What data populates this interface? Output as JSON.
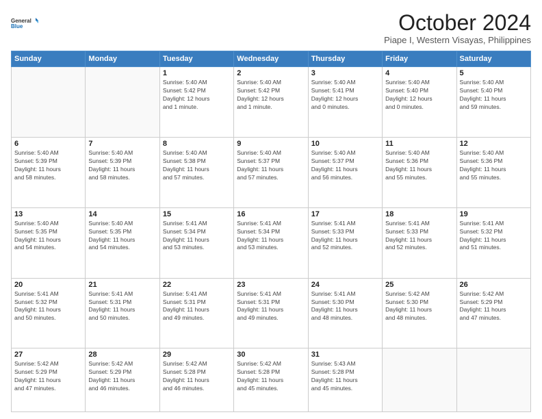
{
  "header": {
    "logo_line1": "General",
    "logo_line2": "Blue",
    "title": "October 2024",
    "subtitle": "Piape I, Western Visayas, Philippines"
  },
  "days_of_week": [
    "Sunday",
    "Monday",
    "Tuesday",
    "Wednesday",
    "Thursday",
    "Friday",
    "Saturday"
  ],
  "weeks": [
    [
      {
        "day": "",
        "info": ""
      },
      {
        "day": "",
        "info": ""
      },
      {
        "day": "1",
        "info": "Sunrise: 5:40 AM\nSunset: 5:42 PM\nDaylight: 12 hours\nand 1 minute."
      },
      {
        "day": "2",
        "info": "Sunrise: 5:40 AM\nSunset: 5:42 PM\nDaylight: 12 hours\nand 1 minute."
      },
      {
        "day": "3",
        "info": "Sunrise: 5:40 AM\nSunset: 5:41 PM\nDaylight: 12 hours\nand 0 minutes."
      },
      {
        "day": "4",
        "info": "Sunrise: 5:40 AM\nSunset: 5:40 PM\nDaylight: 12 hours\nand 0 minutes."
      },
      {
        "day": "5",
        "info": "Sunrise: 5:40 AM\nSunset: 5:40 PM\nDaylight: 11 hours\nand 59 minutes."
      }
    ],
    [
      {
        "day": "6",
        "info": "Sunrise: 5:40 AM\nSunset: 5:39 PM\nDaylight: 11 hours\nand 58 minutes."
      },
      {
        "day": "7",
        "info": "Sunrise: 5:40 AM\nSunset: 5:39 PM\nDaylight: 11 hours\nand 58 minutes."
      },
      {
        "day": "8",
        "info": "Sunrise: 5:40 AM\nSunset: 5:38 PM\nDaylight: 11 hours\nand 57 minutes."
      },
      {
        "day": "9",
        "info": "Sunrise: 5:40 AM\nSunset: 5:37 PM\nDaylight: 11 hours\nand 57 minutes."
      },
      {
        "day": "10",
        "info": "Sunrise: 5:40 AM\nSunset: 5:37 PM\nDaylight: 11 hours\nand 56 minutes."
      },
      {
        "day": "11",
        "info": "Sunrise: 5:40 AM\nSunset: 5:36 PM\nDaylight: 11 hours\nand 55 minutes."
      },
      {
        "day": "12",
        "info": "Sunrise: 5:40 AM\nSunset: 5:36 PM\nDaylight: 11 hours\nand 55 minutes."
      }
    ],
    [
      {
        "day": "13",
        "info": "Sunrise: 5:40 AM\nSunset: 5:35 PM\nDaylight: 11 hours\nand 54 minutes."
      },
      {
        "day": "14",
        "info": "Sunrise: 5:40 AM\nSunset: 5:35 PM\nDaylight: 11 hours\nand 54 minutes."
      },
      {
        "day": "15",
        "info": "Sunrise: 5:41 AM\nSunset: 5:34 PM\nDaylight: 11 hours\nand 53 minutes."
      },
      {
        "day": "16",
        "info": "Sunrise: 5:41 AM\nSunset: 5:34 PM\nDaylight: 11 hours\nand 53 minutes."
      },
      {
        "day": "17",
        "info": "Sunrise: 5:41 AM\nSunset: 5:33 PM\nDaylight: 11 hours\nand 52 minutes."
      },
      {
        "day": "18",
        "info": "Sunrise: 5:41 AM\nSunset: 5:33 PM\nDaylight: 11 hours\nand 52 minutes."
      },
      {
        "day": "19",
        "info": "Sunrise: 5:41 AM\nSunset: 5:32 PM\nDaylight: 11 hours\nand 51 minutes."
      }
    ],
    [
      {
        "day": "20",
        "info": "Sunrise: 5:41 AM\nSunset: 5:32 PM\nDaylight: 11 hours\nand 50 minutes."
      },
      {
        "day": "21",
        "info": "Sunrise: 5:41 AM\nSunset: 5:31 PM\nDaylight: 11 hours\nand 50 minutes."
      },
      {
        "day": "22",
        "info": "Sunrise: 5:41 AM\nSunset: 5:31 PM\nDaylight: 11 hours\nand 49 minutes."
      },
      {
        "day": "23",
        "info": "Sunrise: 5:41 AM\nSunset: 5:31 PM\nDaylight: 11 hours\nand 49 minutes."
      },
      {
        "day": "24",
        "info": "Sunrise: 5:41 AM\nSunset: 5:30 PM\nDaylight: 11 hours\nand 48 minutes."
      },
      {
        "day": "25",
        "info": "Sunrise: 5:42 AM\nSunset: 5:30 PM\nDaylight: 11 hours\nand 48 minutes."
      },
      {
        "day": "26",
        "info": "Sunrise: 5:42 AM\nSunset: 5:29 PM\nDaylight: 11 hours\nand 47 minutes."
      }
    ],
    [
      {
        "day": "27",
        "info": "Sunrise: 5:42 AM\nSunset: 5:29 PM\nDaylight: 11 hours\nand 47 minutes."
      },
      {
        "day": "28",
        "info": "Sunrise: 5:42 AM\nSunset: 5:29 PM\nDaylight: 11 hours\nand 46 minutes."
      },
      {
        "day": "29",
        "info": "Sunrise: 5:42 AM\nSunset: 5:28 PM\nDaylight: 11 hours\nand 46 minutes."
      },
      {
        "day": "30",
        "info": "Sunrise: 5:42 AM\nSunset: 5:28 PM\nDaylight: 11 hours\nand 45 minutes."
      },
      {
        "day": "31",
        "info": "Sunrise: 5:43 AM\nSunset: 5:28 PM\nDaylight: 11 hours\nand 45 minutes."
      },
      {
        "day": "",
        "info": ""
      },
      {
        "day": "",
        "info": ""
      }
    ]
  ]
}
